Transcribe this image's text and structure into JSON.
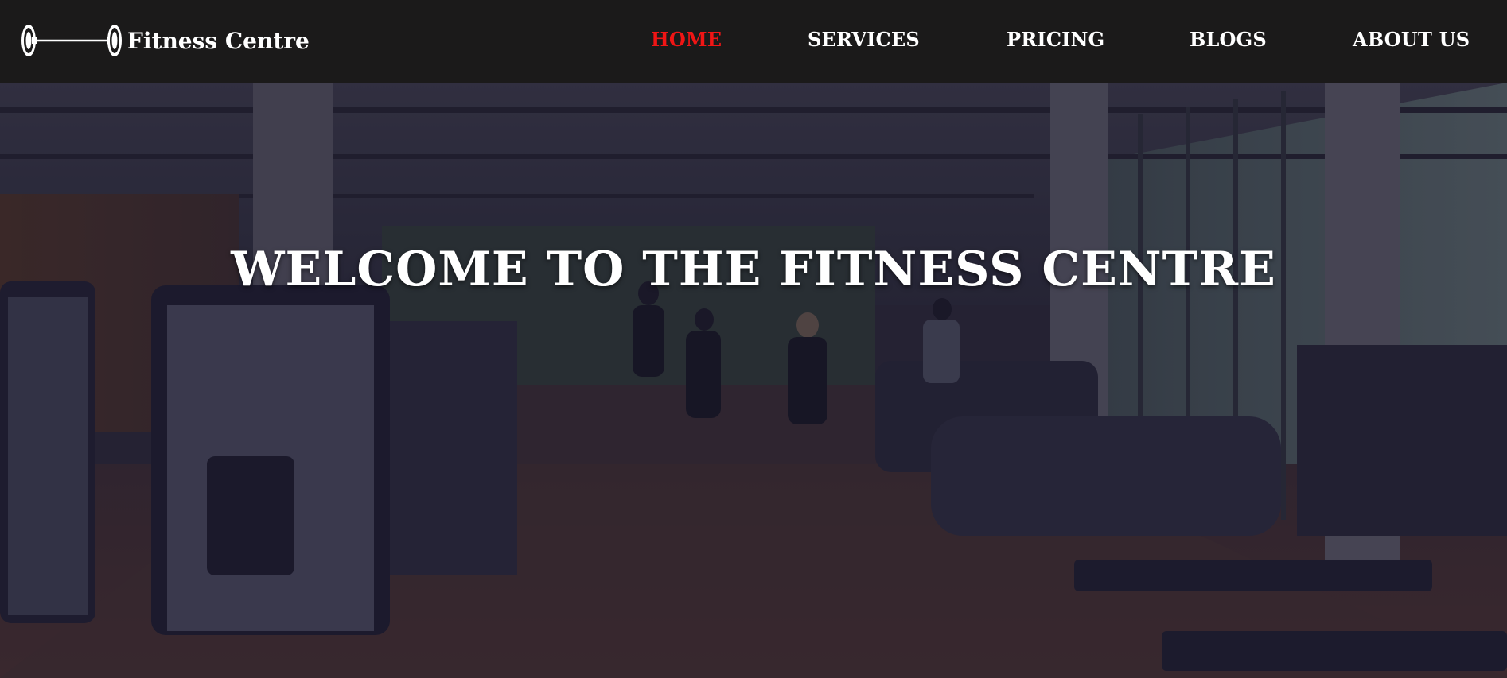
{
  "brand": {
    "name": "Fitness Centre",
    "logo_icon": "barbell-icon"
  },
  "nav": {
    "items": [
      {
        "label": "HOME",
        "active": true
      },
      {
        "label": "SERVICES",
        "active": false
      },
      {
        "label": "PRICING",
        "active": false
      },
      {
        "label": "BLOGS",
        "active": false
      },
      {
        "label": "ABOUT US",
        "active": false
      }
    ],
    "active_color": "#f11515",
    "text_color": "#ffffff",
    "background": "#1b1a1a"
  },
  "hero": {
    "title": "WELCOME TO THE FITNESS CENTRE",
    "background_image": "gym-interior-photo",
    "overlay_color": "#1c1a3a"
  }
}
